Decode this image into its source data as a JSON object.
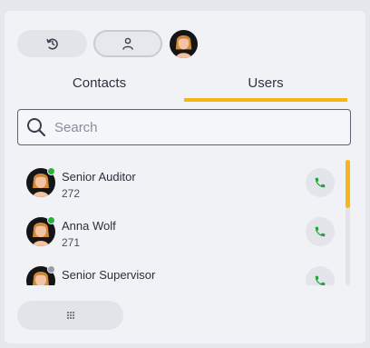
{
  "toolbar": {
    "history_icon": "history-icon",
    "user_icon": "user-icon"
  },
  "tabs": [
    {
      "label": "Contacts",
      "active": false
    },
    {
      "label": "Users",
      "active": true
    }
  ],
  "search": {
    "placeholder": "Search",
    "value": ""
  },
  "users": [
    {
      "name": "Senior Auditor",
      "ext": "272",
      "status": "online",
      "status_color": "#27b33a"
    },
    {
      "name": "Anna Wolf",
      "ext": "271",
      "status": "online",
      "status_color": "#27b33a"
    },
    {
      "name": "Senior Supervisor",
      "ext": "",
      "status": "offline",
      "status_color": "#9a9ca5"
    }
  ],
  "colors": {
    "accent": "#f5b617",
    "call_green": "#27a238"
  }
}
